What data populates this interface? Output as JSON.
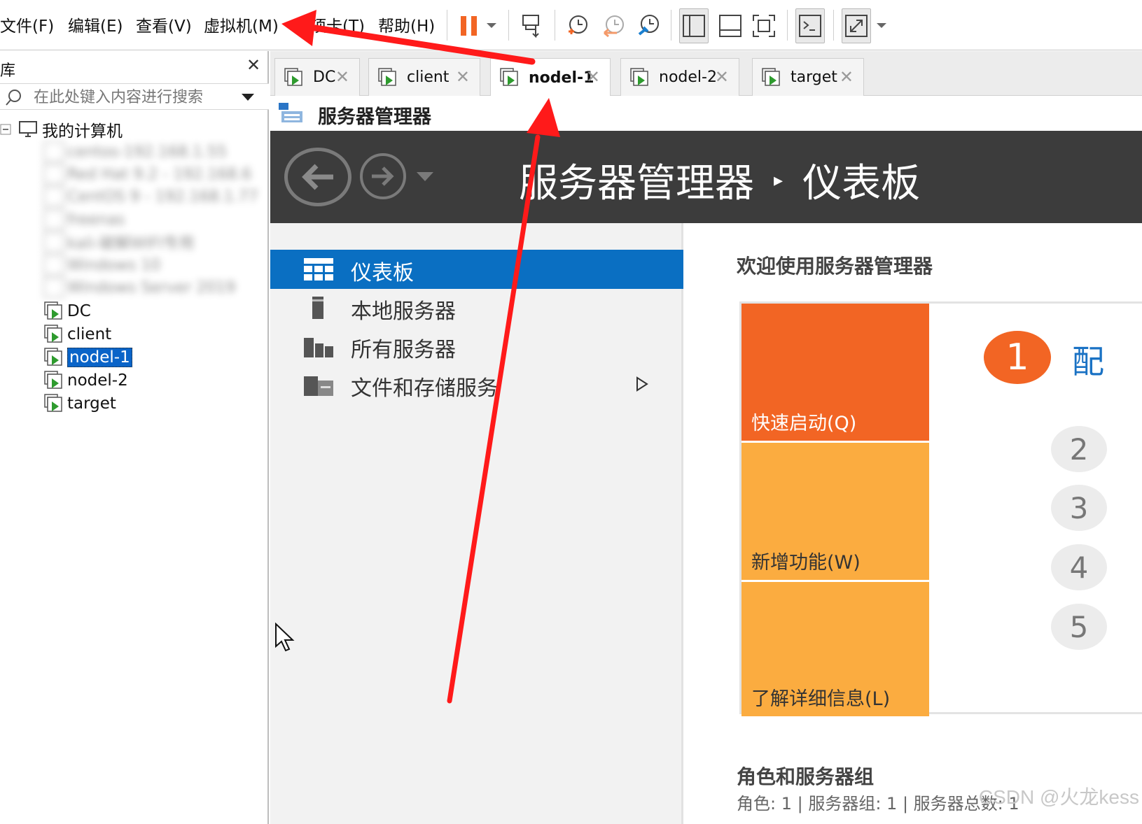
{
  "menubar": {
    "items": [
      {
        "label": "文件(F)"
      },
      {
        "label": "编辑(E)"
      },
      {
        "label": "查看(V)"
      },
      {
        "label": "虚拟机(M)"
      },
      {
        "label": "选项卡(T)"
      },
      {
        "label": "帮助(H)"
      }
    ],
    "toolbar_icons": [
      "pause-icon",
      "dropdown-arrow-icon",
      "send-ctrl-alt-del-icon",
      "snapshot-take-icon",
      "snapshot-revert-icon",
      "snapshot-manager-icon",
      "view-library-icon",
      "view-thumbnail-icon",
      "fullscreen-icon",
      "console-icon",
      "stretch-icon"
    ],
    "accent_color": "#f26524"
  },
  "library": {
    "title": "库",
    "search_placeholder": "在此处键入内容进行搜索",
    "root_label": "我的计算机",
    "blurred_items": [
      "centos-192.168.1.55",
      "Red Hat 9.2 - 192.168.6",
      "CentOS 9 - 192.168.1.77",
      "freenas",
      "kali-破解WIFI专用",
      "Windows 10",
      "Windows Server 2019"
    ],
    "vms": [
      {
        "label": "DC"
      },
      {
        "label": "client"
      },
      {
        "label": "nodel-1"
      },
      {
        "label": "nodel-2"
      },
      {
        "label": "target"
      }
    ],
    "selected_index": 2
  },
  "tabs": [
    {
      "label": "DC"
    },
    {
      "label": "client"
    },
    {
      "label": "nodel-1"
    },
    {
      "label": "nodel-2"
    },
    {
      "label": "target"
    }
  ],
  "active_tab_index": 2,
  "vm": {
    "window_title": "服务器管理器",
    "heading_app": "服务器管理器",
    "heading_page": "仪表板",
    "nav": [
      {
        "label": "仪表板"
      },
      {
        "label": "本地服务器"
      },
      {
        "label": "所有服务器"
      },
      {
        "label": "文件和存储服务"
      }
    ],
    "welcome": "欢迎使用服务器管理器",
    "tiles": {
      "quick_start": "快速启动(Q)",
      "whats_new": "新增功能(W)",
      "learn_more": "了解详细信息(L)"
    },
    "steps": {
      "first_number": "1",
      "first_label": "配",
      "others": [
        "2",
        "3",
        "4",
        "5"
      ]
    },
    "roles_heading": "角色和服务器组",
    "roles_sub": "角色: 1 | 服务器组: 1 | 服务器总数: 1",
    "colors": {
      "quick_start": "#f26524",
      "tile_light": "#fbac40",
      "nav_active": "#0a6fc2",
      "header_bg": "#3c3c3c"
    }
  },
  "watermark": "CSDN @火龙kess",
  "annotation_color": "#ff1a1a"
}
